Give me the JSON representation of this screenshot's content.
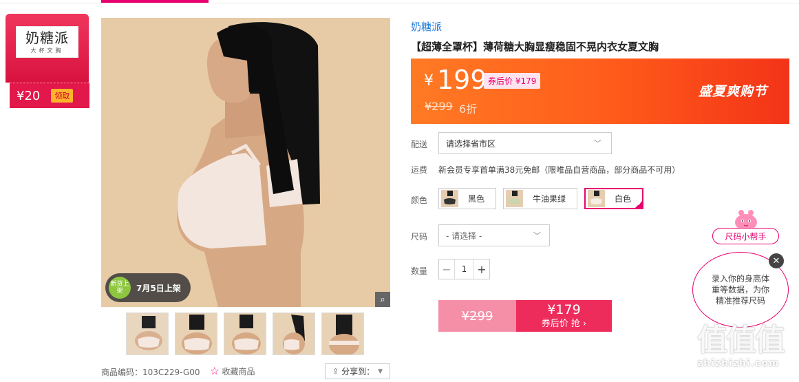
{
  "coupon": {
    "logo_title": "奶糖派",
    "logo_sub": "大杯文胸",
    "amount": "¥20",
    "claim_label": "领取"
  },
  "gallery": {
    "launch_circle": "新货上架",
    "launch_text": "7月5日上架",
    "zoom_icon": "magnifier-icon",
    "thumbnail_count": 5
  },
  "footer": {
    "sku": "商品编码：103C229-G00",
    "favorite_label": "收藏商品",
    "share_label": "分享到："
  },
  "product": {
    "brand": "奶糖派",
    "title": "【超薄全罩杯】薄荷糖大胸显瘦稳固不晃内衣女夏文胸"
  },
  "price": {
    "currency": "¥",
    "value": "199",
    "coupon_price": "券后价 ¥179",
    "original": "¥299",
    "discount": "6折",
    "festival": "盛夏爽购节"
  },
  "delivery": {
    "label": "配送",
    "placeholder": "请选择省市区"
  },
  "shipping": {
    "label": "运费",
    "note": "新会员专享首单满38元免邮（限唯品自营商品，部分商品不可用）"
  },
  "color": {
    "label": "颜色",
    "options": [
      {
        "name": "黑色",
        "selected": false
      },
      {
        "name": "牛油果绿",
        "selected": false
      },
      {
        "name": "白色",
        "selected": true
      }
    ]
  },
  "size": {
    "label": "尺码",
    "placeholder": "- 请选择 -"
  },
  "quantity": {
    "label": "数量",
    "value": "1",
    "minus": "−",
    "plus": "+"
  },
  "buy": {
    "original": "¥299",
    "price": "¥179",
    "sub": "券后价 抢 ›"
  },
  "helper": {
    "tag": "尺码小帮手",
    "line1": "录入你的身高体",
    "line2": "重等数据，为你",
    "line3": "精准推荐尺码",
    "close": "✕"
  },
  "watermark": {
    "chars": "值值值",
    "url": "zhizhizhi.com"
  },
  "colors": {
    "accent": "#e8006f",
    "price_bg_start": "#ff7a24",
    "price_bg_end": "#f33318",
    "buy_button": "#ee2c5c",
    "buy_button_light": "#f58fa8",
    "brand_link": "#1f7ad8"
  }
}
